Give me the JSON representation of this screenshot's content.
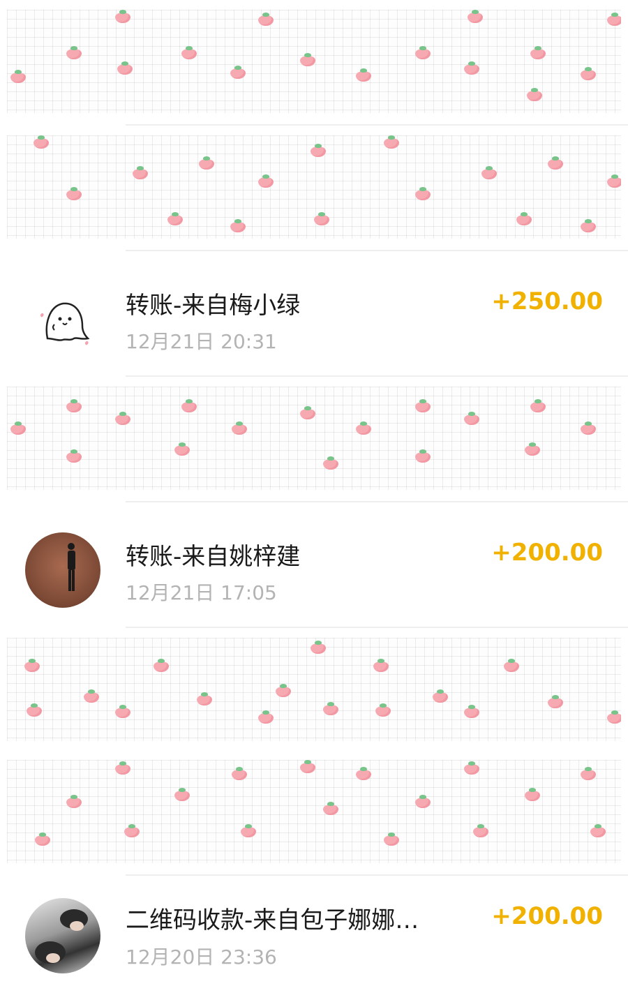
{
  "transactions": [
    {
      "hidden": true
    },
    {
      "hidden": true
    },
    {
      "hidden": false,
      "avatar": "ghost-avatar",
      "title": "转账-来自梅小绿",
      "time": "12月21日 20:31",
      "amount": "+250.00"
    },
    {
      "hidden": true
    },
    {
      "hidden": false,
      "avatar": "person-photo-avatar",
      "title": "转账-来自姚梓建",
      "time": "12月21日 17:05",
      "amount": "+200.00"
    },
    {
      "hidden": true
    },
    {
      "hidden": true
    },
    {
      "hidden": false,
      "avatar": "two-people-photo-avatar",
      "title": "二维码收款-来自包子娜娜…",
      "time": "12月20日 23:36",
      "amount": "+200.00"
    }
  ],
  "colors": {
    "amount": "#f0b100",
    "title": "#1a1a1a",
    "time": "#b3b3b3",
    "sticker_berry": "#f7a9b2",
    "sticker_leaf": "#79c48a"
  },
  "icons": [
    "ghost-avatar",
    "person-photo-avatar",
    "two-people-photo-avatar",
    "strawberry-sticker"
  ]
}
